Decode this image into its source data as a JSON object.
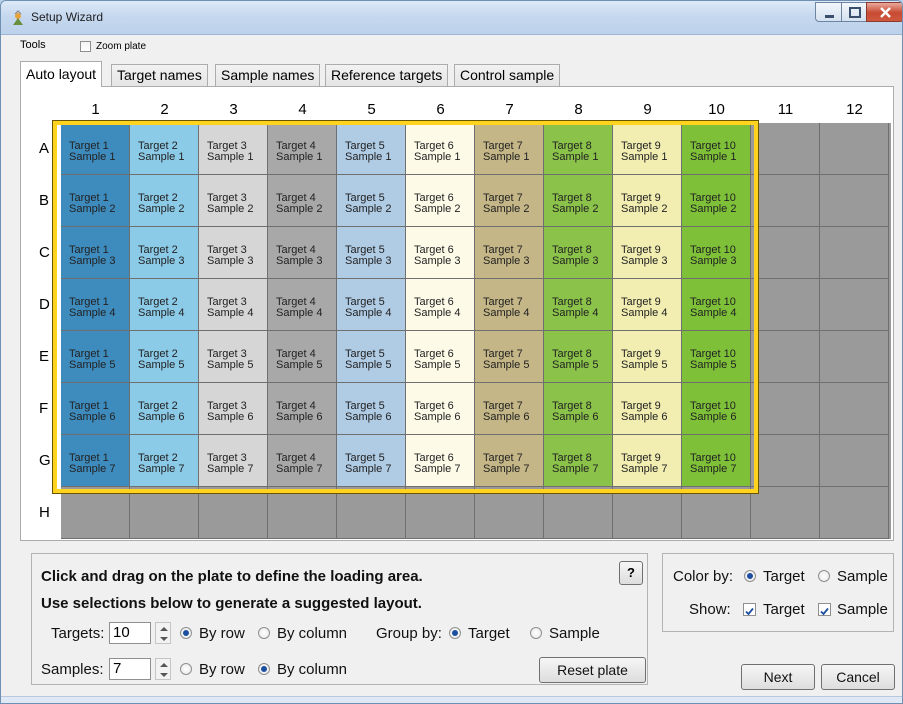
{
  "window": {
    "title": "Setup Wizard"
  },
  "menu": {
    "tools": "Tools",
    "zoom_plate": "Zoom plate"
  },
  "tabs": [
    {
      "label": "Auto layout",
      "active": true
    },
    {
      "label": "Target names",
      "active": false
    },
    {
      "label": "Sample names",
      "active": false
    },
    {
      "label": "Reference targets",
      "active": false
    },
    {
      "label": "Control sample",
      "active": false
    }
  ],
  "plate": {
    "columns": [
      "1",
      "2",
      "3",
      "4",
      "5",
      "6",
      "7",
      "8",
      "9",
      "10",
      "11",
      "12"
    ],
    "rows": [
      "A",
      "B",
      "C",
      "D",
      "E",
      "F",
      "G",
      "H"
    ],
    "empty_well_color": "#9a9a9a",
    "selection_color": "#ffd31e",
    "target_colors": [
      "#3e8bbd",
      "#8ccbe8",
      "#d6d6d6",
      "#a8a8a8",
      "#b0cbe4",
      "#fdfbe8",
      "#c4b687",
      "#8bc34a",
      "#f2eeb2",
      "#7ec139"
    ],
    "wells": [
      [
        {
          "target": "Target 1",
          "sample": "Sample 1"
        },
        {
          "target": "Target 2",
          "sample": "Sample 1"
        },
        {
          "target": "Target 3",
          "sample": "Sample 1"
        },
        {
          "target": "Target 4",
          "sample": "Sample 1"
        },
        {
          "target": "Target 5",
          "sample": "Sample 1"
        },
        {
          "target": "Target 6",
          "sample": "Sample 1"
        },
        {
          "target": "Target 7",
          "sample": "Sample 1"
        },
        {
          "target": "Target 8",
          "sample": "Sample 1"
        },
        {
          "target": "Target 9",
          "sample": "Sample 1"
        },
        {
          "target": "Target 10",
          "sample": "Sample 1"
        }
      ],
      [
        {
          "target": "Target 1",
          "sample": "Sample 2"
        },
        {
          "target": "Target 2",
          "sample": "Sample 2"
        },
        {
          "target": "Target 3",
          "sample": "Sample 2"
        },
        {
          "target": "Target 4",
          "sample": "Sample 2"
        },
        {
          "target": "Target 5",
          "sample": "Sample 2"
        },
        {
          "target": "Target 6",
          "sample": "Sample 2"
        },
        {
          "target": "Target 7",
          "sample": "Sample 2"
        },
        {
          "target": "Target 8",
          "sample": "Sample 2"
        },
        {
          "target": "Target 9",
          "sample": "Sample 2"
        },
        {
          "target": "Target 10",
          "sample": "Sample 2"
        }
      ],
      [
        {
          "target": "Target 1",
          "sample": "Sample 3"
        },
        {
          "target": "Target 2",
          "sample": "Sample 3"
        },
        {
          "target": "Target 3",
          "sample": "Sample 3"
        },
        {
          "target": "Target 4",
          "sample": "Sample 3"
        },
        {
          "target": "Target 5",
          "sample": "Sample 3"
        },
        {
          "target": "Target 6",
          "sample": "Sample 3"
        },
        {
          "target": "Target 7",
          "sample": "Sample 3"
        },
        {
          "target": "Target 8",
          "sample": "Sample 3"
        },
        {
          "target": "Target 9",
          "sample": "Sample 3"
        },
        {
          "target": "Target 10",
          "sample": "Sample 3"
        }
      ],
      [
        {
          "target": "Target 1",
          "sample": "Sample 4"
        },
        {
          "target": "Target 2",
          "sample": "Sample 4"
        },
        {
          "target": "Target 3",
          "sample": "Sample 4"
        },
        {
          "target": "Target 4",
          "sample": "Sample 4"
        },
        {
          "target": "Target 5",
          "sample": "Sample 4"
        },
        {
          "target": "Target 6",
          "sample": "Sample 4"
        },
        {
          "target": "Target 7",
          "sample": "Sample 4"
        },
        {
          "target": "Target 8",
          "sample": "Sample 4"
        },
        {
          "target": "Target 9",
          "sample": "Sample 4"
        },
        {
          "target": "Target 10",
          "sample": "Sample 4"
        }
      ],
      [
        {
          "target": "Target 1",
          "sample": "Sample 5"
        },
        {
          "target": "Target 2",
          "sample": "Sample 5"
        },
        {
          "target": "Target 3",
          "sample": "Sample 5"
        },
        {
          "target": "Target 4",
          "sample": "Sample 5"
        },
        {
          "target": "Target 5",
          "sample": "Sample 5"
        },
        {
          "target": "Target 6",
          "sample": "Sample 5"
        },
        {
          "target": "Target 7",
          "sample": "Sample 5"
        },
        {
          "target": "Target 8",
          "sample": "Sample 5"
        },
        {
          "target": "Target 9",
          "sample": "Sample 5"
        },
        {
          "target": "Target 10",
          "sample": "Sample 5"
        }
      ],
      [
        {
          "target": "Target 1",
          "sample": "Sample 6"
        },
        {
          "target": "Target 2",
          "sample": "Sample 6"
        },
        {
          "target": "Target 3",
          "sample": "Sample 6"
        },
        {
          "target": "Target 4",
          "sample": "Sample 6"
        },
        {
          "target": "Target 5",
          "sample": "Sample 6"
        },
        {
          "target": "Target 6",
          "sample": "Sample 6"
        },
        {
          "target": "Target 7",
          "sample": "Sample 6"
        },
        {
          "target": "Target 8",
          "sample": "Sample 6"
        },
        {
          "target": "Target 9",
          "sample": "Sample 6"
        },
        {
          "target": "Target 10",
          "sample": "Sample 6"
        }
      ],
      [
        {
          "target": "Target 1",
          "sample": "Sample 7"
        },
        {
          "target": "Target 2",
          "sample": "Sample 7"
        },
        {
          "target": "Target 3",
          "sample": "Sample 7"
        },
        {
          "target": "Target 4",
          "sample": "Sample 7"
        },
        {
          "target": "Target 5",
          "sample": "Sample 7"
        },
        {
          "target": "Target 6",
          "sample": "Sample 7"
        },
        {
          "target": "Target 7",
          "sample": "Sample 7"
        },
        {
          "target": "Target 8",
          "sample": "Sample 7"
        },
        {
          "target": "Target 9",
          "sample": "Sample 7"
        },
        {
          "target": "Target 10",
          "sample": "Sample 7"
        }
      ]
    ]
  },
  "instructions": {
    "line1": "Click and drag on the plate to define the loading area.",
    "line2": "Use selections below to generate a suggested layout.",
    "help": "?"
  },
  "targets": {
    "label": "Targets:",
    "value": "10",
    "by_row": "By row",
    "by_column": "By column",
    "selected": "row"
  },
  "samples": {
    "label": "Samples:",
    "value": "7",
    "by_row": "By row",
    "by_column": "By column",
    "selected": "column"
  },
  "group_by": {
    "label": "Group by:",
    "target": "Target",
    "sample": "Sample",
    "selected": "target"
  },
  "reset_label": "Reset plate",
  "color_by": {
    "label": "Color by:",
    "target": "Target",
    "sample": "Sample",
    "selected": "target"
  },
  "show": {
    "label": "Show:",
    "target": "Target",
    "sample": "Sample",
    "target_checked": true,
    "sample_checked": true
  },
  "footer": {
    "next": "Next",
    "cancel": "Cancel"
  }
}
